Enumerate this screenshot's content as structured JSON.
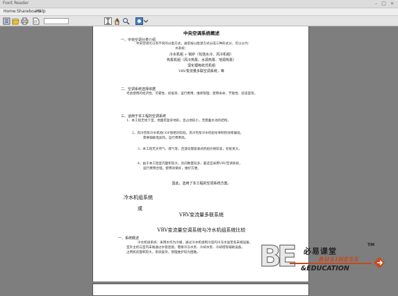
{
  "window": {
    "title": "Foxit Reader"
  },
  "menu": {
    "items": [
      "Home",
      "Shareboard",
      "Help"
    ]
  },
  "toolbar": {
    "search_placeholder": ""
  },
  "document": {
    "title": "中央空调系统概述",
    "section1": {
      "heading": "一、中央空调分类介绍",
      "intro": "中央空调可以有不同的分类方式，通常按以能源方式分成三种形式分，可以分为：",
      "types_lead": "水系统：",
      "item1": "冷水机组 + 锅炉（包括水冷、风冷机组）",
      "item2": "热泵机组（风冷热泵、水源热泵、地源热泵）",
      "item3": "溴化锂吸收式机组",
      "item4": "VRV变流量多联空调系统，等"
    },
    "section2": {
      "heading": "二、空调系统选择依据",
      "body": "考虑使用的经济性、可靠性、初投资、运行费用、维修管理、使用寿命、节能性、舒适度等。"
    },
    "section3": {
      "heading": "三、适用于本工程的空调系统",
      "p1": "1、本工程无地下室，地面有复杂地形，且占地较小，无需蓄水池的结构。",
      "p2": "2、风冷热泵冷水机组COP值相对较低，风冷热泵冷水机组冬季制热效率偏低，",
      "p2b": "需要辅助电加热，运行费用高。",
      "p3": "3、本工程无天然气、煤气等，且溴化锂吸收式机组价格较高，初投资大。",
      "p4": "4、由于本工程室内面积较大，房间数量较多，最适宜采用VRV空调系统，",
      "p4b": "运行费用合理，使用效果好，维护方便。",
      "conclusion": "因此，选用了本工程的空调系统方案。"
    },
    "headings": {
      "cold_water": "冷水机组系统",
      "or": "或",
      "vrv": "VRV变流量多联系统",
      "compare": "VRV变流量空调系统与冷水机组系统比较"
    },
    "section4": {
      "heading": "一、系统概述",
      "p1": "冷水机组系统：采用水作为冷媒，通过冷水机组制冷后的冷冻水送至各末端设备，",
      "p2": "室外主机与室内末端通过水管连接，需要冷冻水泵、冷却水泵、冷却塔等辅助设备，",
      "p3": "占用机房面积较大，系统复杂，管理维护较为困难。"
    }
  },
  "logo": {
    "letters": "BE",
    "chinese": "必易课堂",
    "trademark": "TM",
    "business": "BUSINESS",
    "education": "&EDUCATION"
  }
}
